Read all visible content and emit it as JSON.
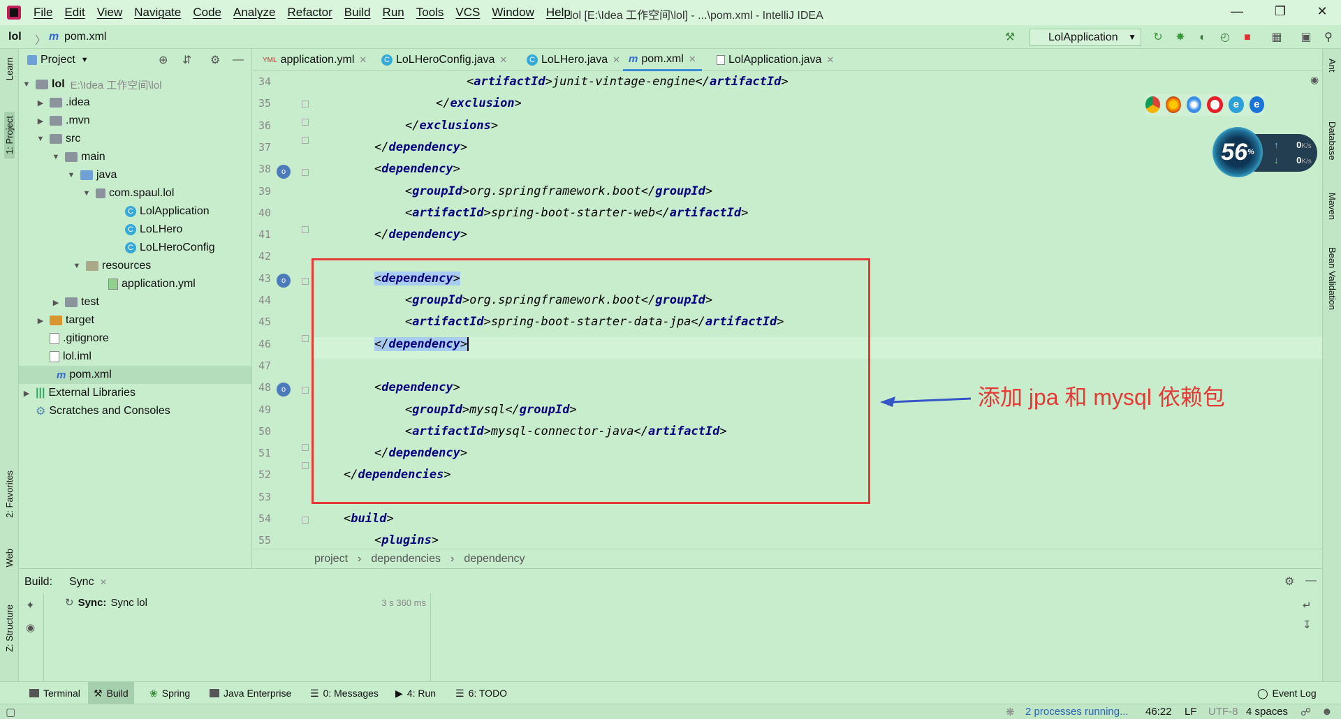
{
  "window": {
    "title": "lol [E:\\Idea 工作空间\\lol] - ...\\pom.xml - IntelliJ IDEA"
  },
  "menu": [
    "File",
    "Edit",
    "View",
    "Navigate",
    "Code",
    "Analyze",
    "Refactor",
    "Build",
    "Run",
    "Tools",
    "VCS",
    "Window",
    "Help"
  ],
  "navbar": {
    "project": "lol",
    "file": "pom.xml",
    "run_config": "LolApplication"
  },
  "left_strip": {
    "learn": "Learn",
    "project": "1: Project",
    "favorites": "2: Favorites",
    "web": "Web",
    "structure": "Z: Structure"
  },
  "right_strip": {
    "ant": "Ant",
    "database": "Database",
    "maven": "Maven",
    "bean": "Bean Validation"
  },
  "project_panel": {
    "title": "Project",
    "root_name": "lol",
    "root_path": "E:\\Idea 工作空间\\lol",
    "items": [
      {
        "label": ".idea"
      },
      {
        "label": ".mvn"
      },
      {
        "label": "src"
      },
      {
        "label": "main"
      },
      {
        "label": "java"
      },
      {
        "label": "com.spaul.lol"
      },
      {
        "label": "LolApplication"
      },
      {
        "label": "LoLHero"
      },
      {
        "label": "LoLHeroConfig"
      },
      {
        "label": "resources"
      },
      {
        "label": "application.yml"
      },
      {
        "label": "test"
      },
      {
        "label": "target"
      },
      {
        "label": ".gitignore"
      },
      {
        "label": "lol.iml"
      },
      {
        "label": "pom.xml"
      },
      {
        "label": "External Libraries"
      },
      {
        "label": "Scratches and Consoles"
      }
    ]
  },
  "editor_tabs": [
    "application.yml",
    "LoLHeroConfig.java",
    "LoLHero.java",
    "pom.xml",
    "LolApplication.java"
  ],
  "code": {
    "line_numbers": [
      "34",
      "35",
      "36",
      "37",
      "38",
      "39",
      "40",
      "41",
      "42",
      "43",
      "44",
      "45",
      "46",
      "47",
      "48",
      "49",
      "50",
      "51",
      "52",
      "53",
      "54",
      "55"
    ],
    "lines": [
      {
        "pre": "<",
        "tag": "artifactId",
        "mid": ">junit-vintage-engine</",
        "tag2": "artifactId",
        "post": ">"
      },
      {
        "pre": "</",
        "tag": "exclusion",
        "mid": ">",
        "tag2": "",
        "post": ""
      },
      {
        "pre": "</",
        "tag": "exclusions",
        "mid": ">",
        "tag2": "",
        "post": ""
      },
      {
        "pre": "</",
        "tag": "dependency",
        "mid": ">",
        "tag2": "",
        "post": ""
      },
      {
        "pre": "<",
        "tag": "dependency",
        "mid": ">",
        "tag2": "",
        "post": ""
      },
      {
        "pre": "<",
        "tag": "groupId",
        "mid": ">org.springframework.boot</",
        "tag2": "groupId",
        "post": ">"
      },
      {
        "pre": "<",
        "tag": "artifactId",
        "mid": ">spring-boot-starter-web</",
        "tag2": "artifactId",
        "post": ">"
      },
      {
        "pre": "</",
        "tag": "dependency",
        "mid": ">",
        "tag2": "",
        "post": ""
      },
      {
        "pre": "",
        "tag": "",
        "mid": "",
        "tag2": "",
        "post": ""
      },
      {
        "pre": "<",
        "tag": "dependency",
        "mid": ">",
        "tag2": "",
        "post": ""
      },
      {
        "pre": "<",
        "tag": "groupId",
        "mid": ">org.springframework.boot</",
        "tag2": "groupId",
        "post": ">"
      },
      {
        "pre": "<",
        "tag": "artifactId",
        "mid": ">spring-boot-starter-data-jpa</",
        "tag2": "artifactId",
        "post": ">"
      },
      {
        "pre": "</",
        "tag": "dependency",
        "mid": ">",
        "tag2": "",
        "post": ""
      },
      {
        "pre": "",
        "tag": "",
        "mid": "",
        "tag2": "",
        "post": ""
      },
      {
        "pre": "<",
        "tag": "dependency",
        "mid": ">",
        "tag2": "",
        "post": ""
      },
      {
        "pre": "<",
        "tag": "groupId",
        "mid": ">mysql</",
        "tag2": "groupId",
        "post": ">"
      },
      {
        "pre": "<",
        "tag": "artifactId",
        "mid": ">mysql-connector-java</",
        "tag2": "artifactId",
        "post": ">"
      },
      {
        "pre": "</",
        "tag": "dependency",
        "mid": ">",
        "tag2": "",
        "post": ""
      },
      {
        "pre": "</",
        "tag": "dependencies",
        "mid": ">",
        "tag2": "",
        "post": ""
      },
      {
        "pre": "",
        "tag": "",
        "mid": "",
        "tag2": "",
        "post": ""
      },
      {
        "pre": "<",
        "tag": "build",
        "mid": ">",
        "tag2": "",
        "post": ""
      },
      {
        "pre": "<",
        "tag": "plugins",
        "mid": ">",
        "tag2": "",
        "post": ""
      }
    ]
  },
  "annotation": {
    "text": "添加 jpa 和 mysql 依赖包",
    "color": "#e53935"
  },
  "speed_widget": {
    "value": "56",
    "unit": "%",
    "up": "0",
    "down": "0",
    "rate_unit": "K/s"
  },
  "editor_breadcrumb": [
    "project",
    "dependencies",
    "dependency"
  ],
  "build": {
    "label": "Build:",
    "tab": "Sync",
    "sync_title": "Sync:",
    "sync_text": "Sync lol",
    "duration": "3 s 360 ms"
  },
  "tool_windows": [
    {
      "label": "Terminal"
    },
    {
      "label": "Build"
    },
    {
      "label": "Spring"
    },
    {
      "label": "Java Enterprise"
    },
    {
      "label": "0: Messages"
    },
    {
      "label": "4: Run"
    },
    {
      "label": "6: TODO"
    }
  ],
  "event_log": "Event Log",
  "status": {
    "processes": "2 processes running...",
    "position": "46:22",
    "line_sep": "LF",
    "encoding": "UTF-8",
    "indent": "4 spaces"
  }
}
